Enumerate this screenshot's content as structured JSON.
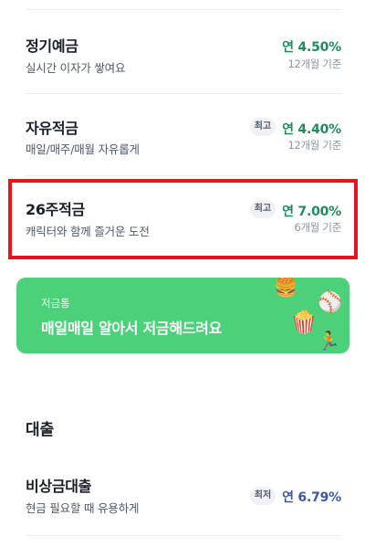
{
  "products": [
    {
      "name": "정기예금",
      "desc": "실시간 이자가 쌓여요",
      "badge": "",
      "rate": "연 4.50%",
      "term": "12개월 기준"
    },
    {
      "name": "자유적금",
      "desc": "매일/매주/매월 자유롭게",
      "badge": "최고",
      "rate": "연 4.40%",
      "term": "12개월 기준"
    },
    {
      "name": "26주적금",
      "desc": "캐릭터와 함께 즐거운 도전",
      "badge": "최고",
      "rate": "연 7.00%",
      "term": "6개월 기준"
    }
  ],
  "banner": {
    "subtitle": "저금통",
    "title": "매일매일 알아서 저금해드려요",
    "emojis": {
      "burger": "🍔",
      "baseball": "⚾",
      "popcorn": "🍿",
      "runner": "🏃"
    }
  },
  "loan_section": {
    "title": "대출",
    "item": {
      "name": "비상금대출",
      "desc": "현금 필요할 때 유용하게",
      "badge": "최저",
      "rate": "연 6.79%"
    }
  },
  "colors": {
    "savings_rate": "#1b8f5a",
    "loan_rate": "#3a57a8",
    "highlight": "#e8141c",
    "banner": "#4cd17a"
  }
}
